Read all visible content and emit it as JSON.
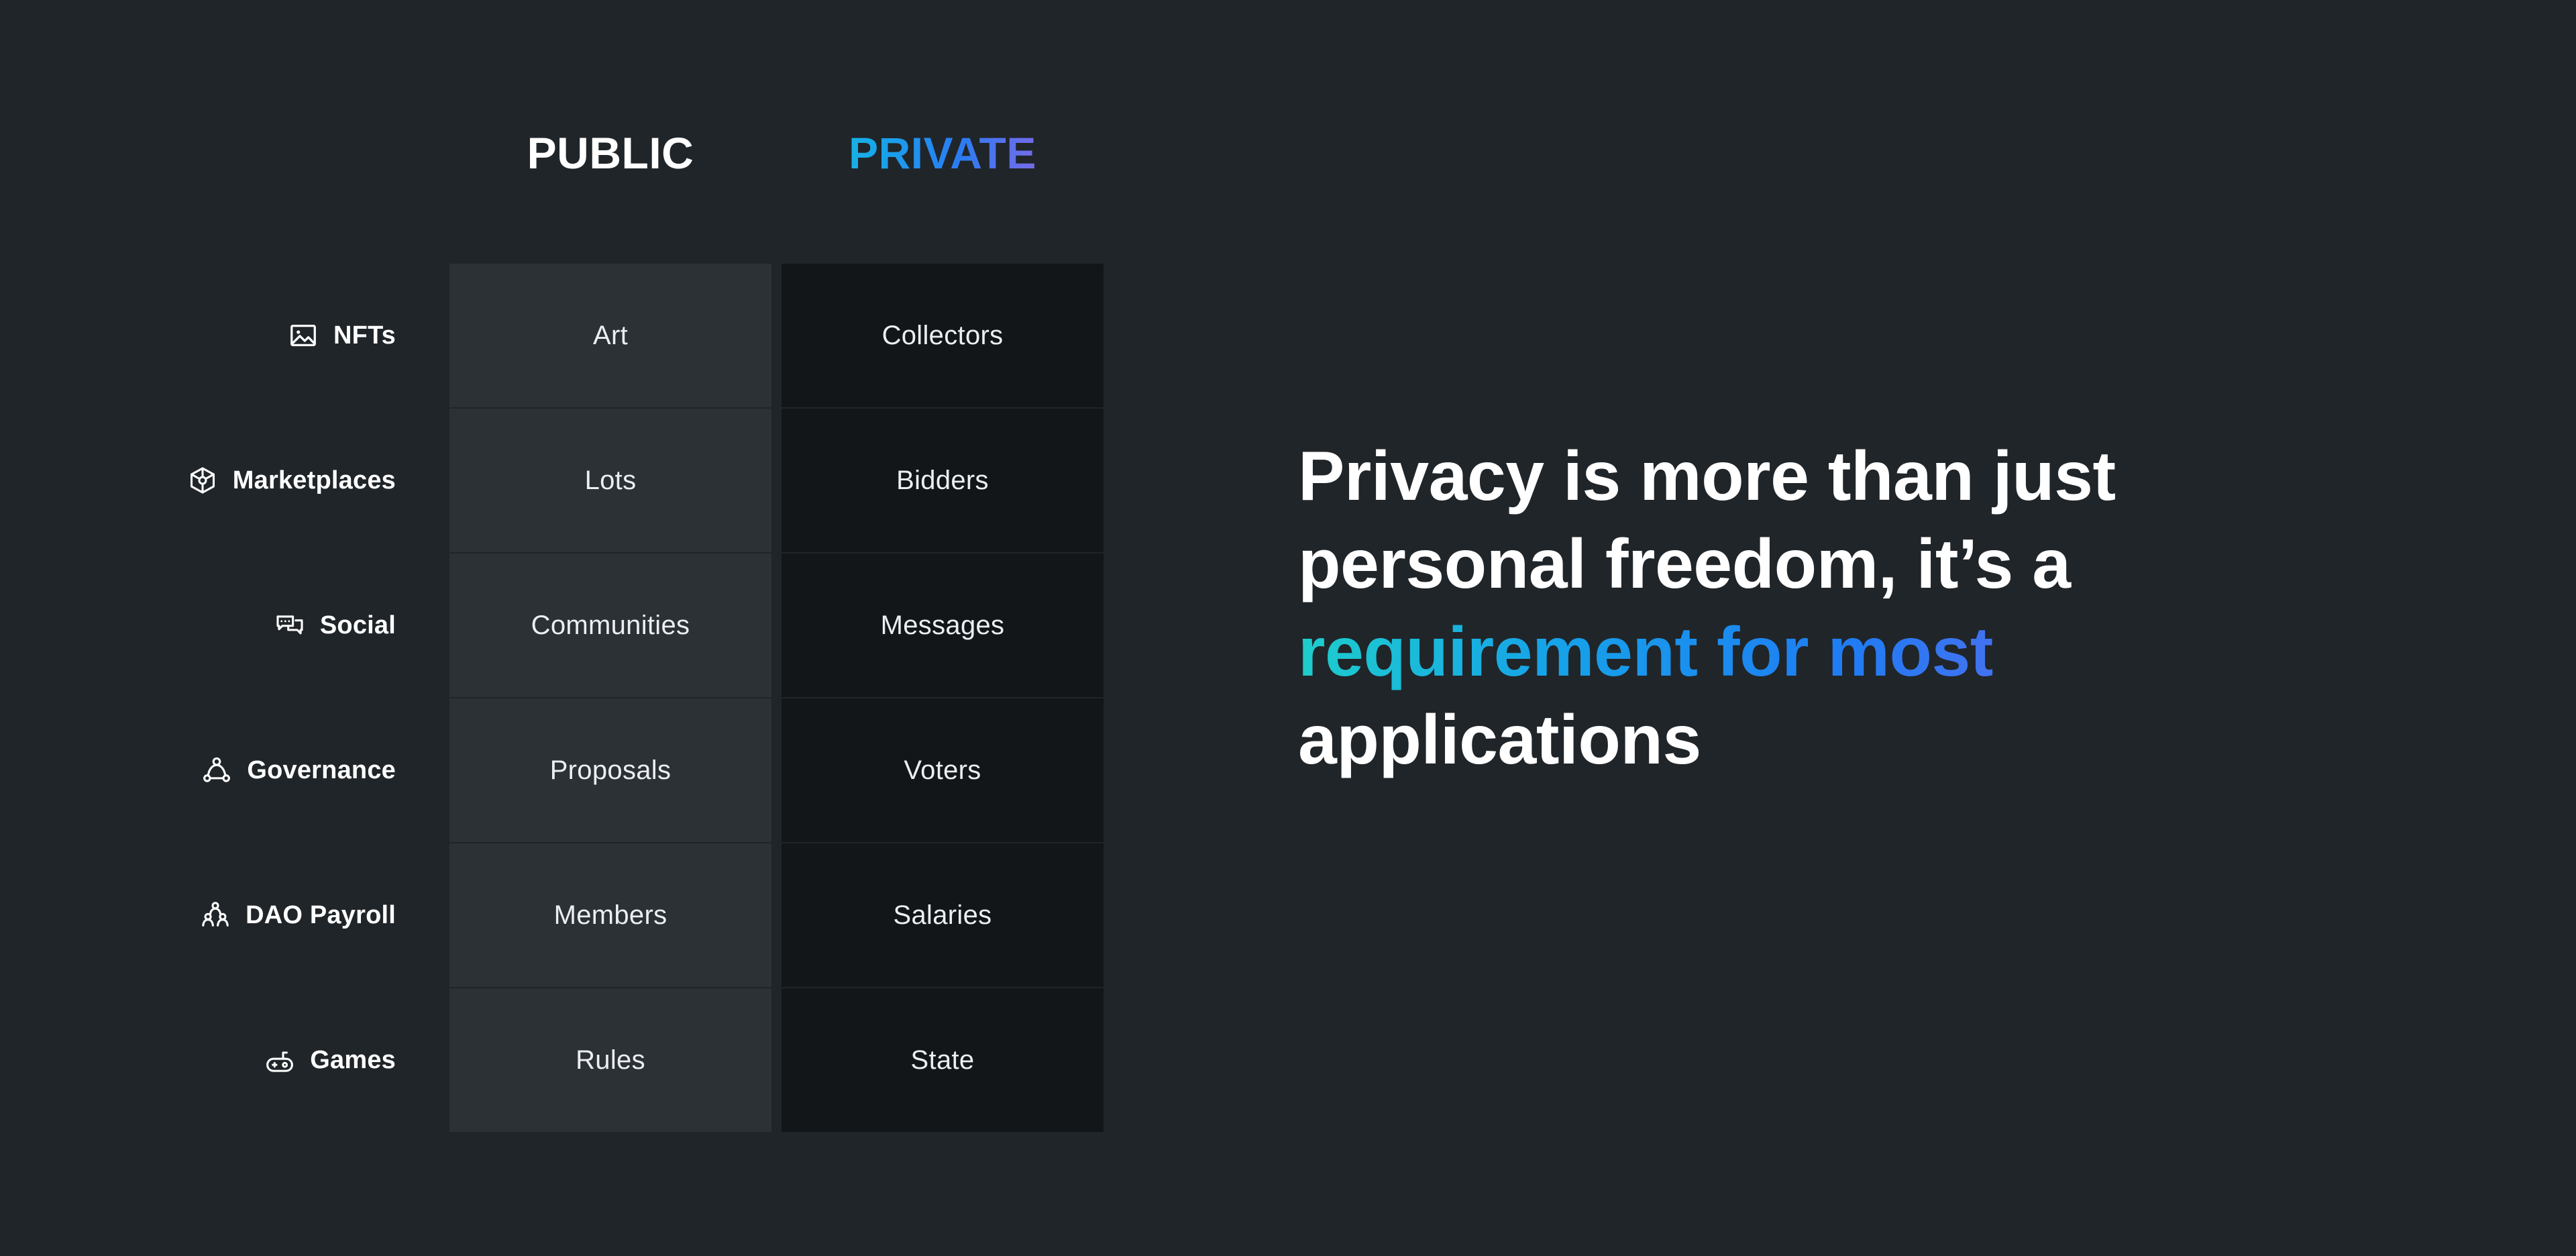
{
  "background_color": "#202529",
  "matrix": {
    "columns": [
      {
        "id": "public",
        "label": "PUBLIC",
        "cell_color": "#2c3136",
        "text_color": "#ffffff"
      },
      {
        "id": "private",
        "label": "PRIVATE",
        "cell_color": "#131619",
        "gradient": [
          "#1ececc",
          "#17a8ea",
          "#2a7cf2",
          "#7a6ae8",
          "#bf7fd8"
        ]
      }
    ],
    "rows": [
      {
        "label": "NFTs",
        "icon": "image-icon",
        "public": "Art",
        "private": "Collectors"
      },
      {
        "label": "Marketplaces",
        "icon": "cube-icon",
        "public": "Lots",
        "private": "Bidders"
      },
      {
        "label": "Social",
        "icon": "chat-icon",
        "public": "Communities",
        "private": "Messages"
      },
      {
        "label": "Governance",
        "icon": "group-icon",
        "public": "Proposals",
        "private": "Voters"
      },
      {
        "label": "DAO Payroll",
        "icon": "org-chart-icon",
        "public": "Members",
        "private": "Salaries"
      },
      {
        "label": "Games",
        "icon": "gamepad-icon",
        "public": "Rules",
        "private": "State"
      }
    ]
  },
  "headline": {
    "line1": "Privacy is more than just",
    "line2": "personal freedom, it’s a",
    "line3_gradient": "requirement for most",
    "line4": "applications",
    "gradient_colors": [
      "#1ececc",
      "#16a3e8",
      "#1f7cf4",
      "#5b6bec",
      "#9a79e0",
      "#c681d6"
    ]
  }
}
